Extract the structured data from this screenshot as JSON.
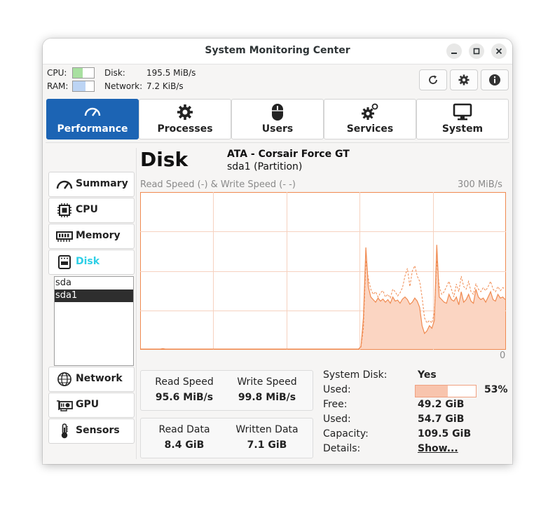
{
  "window": {
    "title": "System Monitoring Center"
  },
  "header": {
    "cpu_label": "CPU:",
    "ram_label": "RAM:",
    "disk_label": "Disk:",
    "disk_value": "195.5 MiB/s",
    "network_label": "Network:",
    "network_value": "7.2 KiB/s",
    "cpu_bar_color": "#a8e0a0",
    "ram_bar_color": "#bcd4f4",
    "cpu_usage_fraction": 0.45,
    "ram_usage_fraction": 0.6
  },
  "toolbar": {
    "icons": [
      "refresh-icon",
      "gear-icon",
      "info-icon"
    ]
  },
  "tabs": [
    {
      "label": "Performance",
      "icon": "gauge-icon",
      "active": true
    },
    {
      "label": "Processes",
      "icon": "gear-icon"
    },
    {
      "label": "Users",
      "icon": "mouse-icon"
    },
    {
      "label": "Services",
      "icon": "gears-icon"
    },
    {
      "label": "System",
      "icon": "monitor-icon"
    }
  ],
  "sidebar": {
    "items": [
      {
        "label": "Summary",
        "icon": "gauge-icon"
      },
      {
        "label": "CPU",
        "icon": "chip-icon"
      },
      {
        "label": "Memory",
        "icon": "ram-icon"
      },
      {
        "label": "Disk",
        "icon": "disk-icon",
        "active": true
      },
      {
        "label": "Network",
        "icon": "globe-icon"
      },
      {
        "label": "GPU",
        "icon": "gpu-icon"
      },
      {
        "label": "Sensors",
        "icon": "thermometer-icon"
      }
    ],
    "devices": [
      "sda",
      "sda1"
    ],
    "selected_device": "sda1"
  },
  "disk": {
    "heading": "Disk",
    "name": "ATA - Corsair Force GT",
    "subtitle": "sda1  (Partition)"
  },
  "chart": {
    "title": "Read Speed (-) & Write Speed (-  -)",
    "max_label": "300 MiB/s",
    "min_label": "0"
  },
  "chart_data": {
    "type": "area",
    "title": "Read Speed (-) & Write Speed (-  -)",
    "ylim": [
      0,
      300
    ],
    "y_max_label": "300 MiB/s",
    "y_min_label": "0",
    "grid": true,
    "line_color": "#f08a50",
    "fill_color": "#fbd5c2",
    "x": [
      0,
      1,
      2,
      3,
      4,
      5,
      6,
      7,
      8,
      9,
      10,
      11,
      12,
      13,
      14,
      15,
      16,
      17,
      18,
      19,
      20,
      21,
      22,
      23,
      24,
      25,
      26,
      27,
      28,
      29,
      30,
      31,
      32,
      33,
      34,
      35,
      36,
      37,
      38,
      39,
      40,
      41,
      42,
      43,
      44,
      45,
      46,
      47,
      48,
      49,
      50,
      51,
      52,
      53,
      54,
      55,
      56,
      57,
      58,
      59,
      60,
      61,
      62,
      63,
      64,
      65,
      66,
      67,
      68,
      69,
      70,
      71,
      72,
      73,
      74,
      75,
      76,
      77,
      78,
      79,
      80,
      81,
      82,
      83,
      84,
      85,
      86,
      87,
      88,
      89,
      90,
      91,
      92,
      93,
      94,
      95,
      96,
      97,
      98,
      99,
      100,
      101,
      102,
      103,
      104,
      105,
      106,
      107,
      108,
      109,
      110,
      111,
      112,
      113,
      114,
      115,
      116,
      117,
      118,
      119,
      120,
      121,
      122,
      123,
      124,
      125,
      126,
      127,
      128,
      129,
      130,
      131,
      132,
      133,
      134,
      135,
      136,
      137,
      138,
      139,
      140,
      141,
      142,
      143,
      144,
      145,
      146,
      147,
      148,
      149
    ],
    "series": [
      {
        "name": "Read Speed",
        "style": "solid",
        "values": [
          0,
          0,
          0,
          0,
          0,
          0,
          0,
          0,
          0,
          1,
          0,
          0,
          0,
          0,
          0,
          0,
          0,
          0,
          0,
          0,
          0,
          0,
          0,
          0,
          0,
          0,
          0,
          0,
          0,
          0,
          0,
          0,
          0,
          0,
          0,
          0,
          0,
          0,
          0,
          0,
          0,
          0,
          0,
          0,
          0,
          0,
          0,
          0,
          0,
          0,
          0,
          0,
          0,
          0,
          0,
          0,
          0,
          0,
          0,
          0,
          0,
          0,
          0,
          0,
          0,
          0,
          0,
          0,
          0,
          0,
          0,
          0,
          0,
          0,
          0,
          0,
          0,
          0,
          0,
          0,
          0,
          0,
          0,
          0,
          0,
          0,
          0,
          0,
          0,
          0,
          5,
          60,
          195,
          120,
          100,
          95,
          90,
          98,
          92,
          96,
          90,
          95,
          88,
          100,
          92,
          94,
          88,
          96,
          100,
          95,
          86,
          90,
          98,
          92,
          80,
          45,
          30,
          35,
          45,
          40,
          55,
          200,
          100,
          95,
          90,
          88,
          105,
          95,
          92,
          100,
          85,
          110,
          90,
          95,
          105,
          92,
          88,
          115,
          100,
          95,
          98,
          90,
          100,
          110,
          95,
          92,
          105,
          98,
          100,
          95
        ]
      },
      {
        "name": "Write Speed",
        "style": "dashed",
        "values": [
          0,
          0,
          0,
          0,
          0,
          0,
          0,
          0,
          0,
          0,
          0,
          0,
          0,
          0,
          0,
          0,
          0,
          0,
          0,
          0,
          0,
          0,
          0,
          0,
          0,
          0,
          0,
          0,
          0,
          0,
          0,
          0,
          0,
          0,
          0,
          0,
          0,
          0,
          0,
          0,
          0,
          0,
          0,
          0,
          0,
          0,
          0,
          0,
          0,
          0,
          0,
          0,
          0,
          0,
          0,
          0,
          0,
          0,
          0,
          0,
          0,
          0,
          0,
          0,
          0,
          0,
          0,
          0,
          0,
          0,
          0,
          0,
          0,
          0,
          0,
          0,
          0,
          0,
          0,
          0,
          0,
          0,
          0,
          0,
          0,
          0,
          0,
          0,
          0,
          0,
          3,
          40,
          170,
          135,
          115,
          105,
          110,
          100,
          108,
          112,
          100,
          105,
          98,
          115,
          110,
          102,
          108,
          118,
          140,
          155,
          120,
          150,
          160,
          140,
          130,
          100,
          60,
          50,
          55,
          50,
          70,
          170,
          120,
          105,
          110,
          120,
          130,
          115,
          100,
          125,
          110,
          140,
          120,
          115,
          130,
          110,
          105,
          125,
          115,
          110,
          118,
          112,
          120,
          130,
          115,
          110,
          120,
          112,
          118,
          115
        ]
      }
    ]
  },
  "stats": {
    "read_speed_label": "Read Speed",
    "read_speed_value": "95.6 MiB/s",
    "write_speed_label": "Write Speed",
    "write_speed_value": "99.8 MiB/s",
    "read_data_label": "Read Data",
    "read_data_value": "8.4 GiB",
    "written_data_label": "Written Data",
    "written_data_value": "7.1 GiB"
  },
  "details": {
    "system_disk_label": "System Disk:",
    "system_disk_value": "Yes",
    "used_label": "Used:",
    "used_percent": 53,
    "used_percent_text": "53%",
    "free_label": "Free:",
    "free_value": "49.2 GiB",
    "used2_label": "Used:",
    "used2_value": "54.7 GiB",
    "capacity_label": "Capacity:",
    "capacity_value": "109.5 GiB",
    "details_label": "Details:",
    "details_link": "Show..."
  }
}
